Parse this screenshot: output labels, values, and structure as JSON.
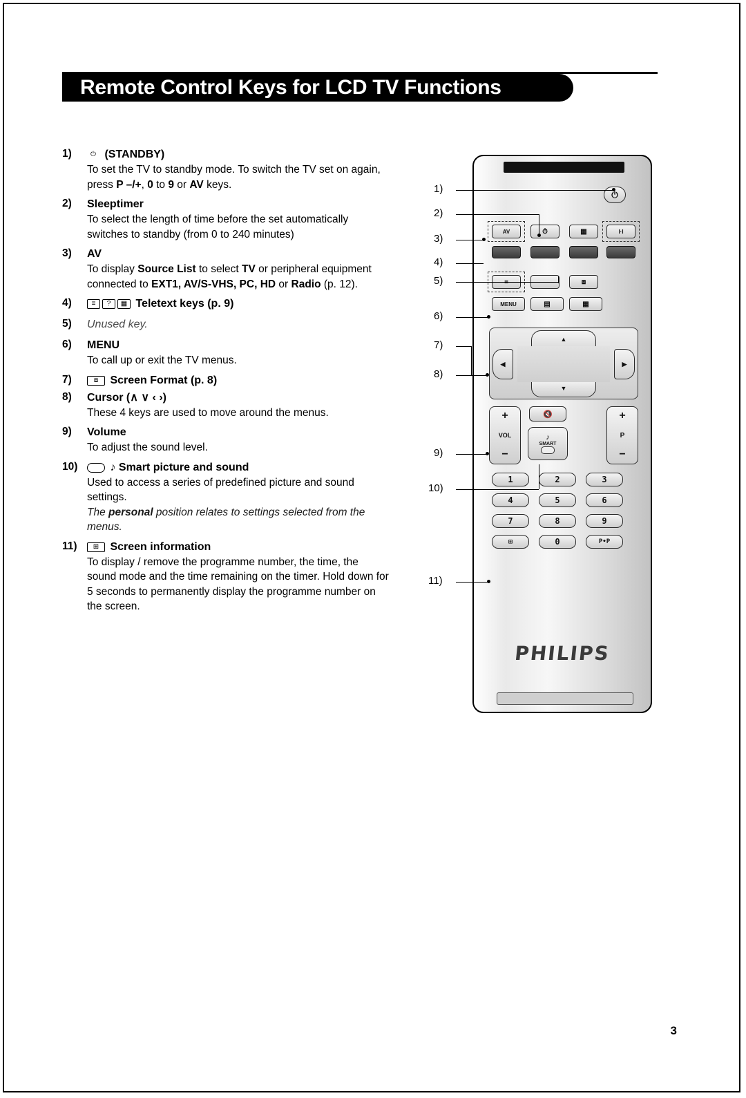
{
  "header": {
    "title": "Remote Control Keys for LCD TV Functions"
  },
  "page_number": "3",
  "brand": "PHILIPS",
  "items": [
    {
      "num": "1)",
      "icon": "power-icon",
      "heading": "(STANDBY)",
      "body_parts": [
        {
          "t": "To set the TV to standby mode. To switch the TV set on again, press ",
          "s": "normal"
        },
        {
          "t": "P –/+",
          "s": "bold"
        },
        {
          "t": ", ",
          "s": "normal"
        },
        {
          "t": "0",
          "s": "bold"
        },
        {
          "t": " to ",
          "s": "normal"
        },
        {
          "t": "9",
          "s": "bold"
        },
        {
          "t": " or ",
          "s": "normal"
        },
        {
          "t": "AV",
          "s": "bold"
        },
        {
          "t": " keys.",
          "s": "normal"
        }
      ]
    },
    {
      "num": "2)",
      "heading": "Sleeptimer",
      "body_parts": [
        {
          "t": "To select the length of time before the set automatically switches to standby (from 0 to 240 minutes)",
          "s": "normal"
        }
      ]
    },
    {
      "num": "3)",
      "heading": "AV",
      "body_parts": [
        {
          "t": "To display ",
          "s": "normal"
        },
        {
          "t": "Source List",
          "s": "bold"
        },
        {
          "t": " to select ",
          "s": "normal"
        },
        {
          "t": "TV",
          "s": "bold"
        },
        {
          "t": " or peripheral equipment connected to ",
          "s": "normal"
        },
        {
          "t": "EXT1, AV/S-VHS, PC, HD",
          "s": "bold"
        },
        {
          "t": " or ",
          "s": "normal"
        },
        {
          "t": "Radio",
          "s": "bold"
        },
        {
          "t": " (p. 12).",
          "s": "normal"
        }
      ]
    },
    {
      "num": "4)",
      "heading": "Teletext keys (p. 9)",
      "icons": [
        "teletext-mix-icon",
        "teletext-reveal-icon",
        "teletext-index-icon"
      ],
      "body_parts": []
    },
    {
      "num": "5)",
      "heading": "Unused key.",
      "heading_style": "italic-gray",
      "body_parts": []
    },
    {
      "num": "6)",
      "heading": "MENU",
      "body_parts": [
        {
          "t": "To call up or exit the TV menus.",
          "s": "normal"
        }
      ]
    },
    {
      "num": "7)",
      "heading": "Screen Format (p. 8)",
      "icons": [
        "screen-format-icon"
      ],
      "body_parts": []
    },
    {
      "num": "8)",
      "heading": "Cursor (∧ ∨ ‹ ›)",
      "body_parts": [
        {
          "t": "These 4 keys are used to move around the menus.",
          "s": "normal"
        }
      ]
    },
    {
      "num": "9)",
      "heading": "Volume",
      "body_parts": [
        {
          "t": "To adjust the sound level.",
          "s": "normal"
        }
      ]
    },
    {
      "num": "10)",
      "heading": "♪ Smart picture and sound",
      "icons": [
        "smart-button-icon"
      ],
      "body_parts": [
        {
          "t": "Used to access a series of predefined picture and sound settings.",
          "s": "normal"
        }
      ],
      "note_parts": [
        {
          "t": "The ",
          "s": "italic"
        },
        {
          "t": "personal",
          "s": "bold-italic"
        },
        {
          "t": " position relates to settings selected from the menus.",
          "s": "italic"
        }
      ]
    },
    {
      "num": "11)",
      "heading": "Screen information",
      "icons": [
        "screen-info-icon"
      ],
      "body_parts": [
        {
          "t": "To display / remove the programme number, the time, the sound mode and the time remaining on the timer. Hold down for 5 seconds to permanently display the programme number on the screen.",
          "s": "normal"
        }
      ]
    }
  ],
  "remote": {
    "callouts": [
      "1)",
      "2)",
      "3)",
      "4)",
      "5)",
      "6)",
      "7)",
      "8)",
      "9)",
      "10)",
      "11)"
    ],
    "buttons": {
      "standby": "⏻",
      "av": "AV",
      "sleep": "⏱",
      "teletext": "≡",
      "format_hi": "I·I",
      "menu": "MENU",
      "vol_label": "VOL",
      "p_label": "P",
      "plus": "+",
      "minus": "−",
      "mute": "✕",
      "smart": "SMART",
      "note": "♪",
      "pp": "P•P",
      "digits": [
        "1",
        "2",
        "3",
        "4",
        "5",
        "6",
        "7",
        "8",
        "9",
        "0"
      ]
    }
  }
}
